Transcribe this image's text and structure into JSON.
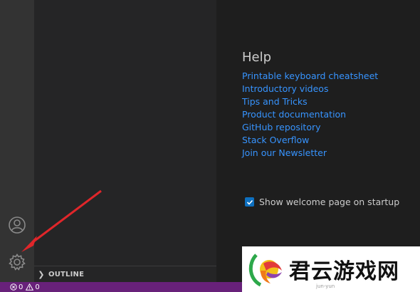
{
  "help": {
    "title": "Help",
    "links": [
      "Printable keyboard cheatsheet",
      "Introductory videos",
      "Tips and Tricks",
      "Product documentation",
      "GitHub repository",
      "Stack Overflow",
      "Join our Newsletter"
    ]
  },
  "startup": {
    "label": "Show welcome page on startup",
    "checked": true
  },
  "sidebar": {
    "outline_label": "OUTLINE"
  },
  "status": {
    "errors": "0",
    "warnings": "0"
  },
  "activity_bar": {
    "icons": [
      "account-icon",
      "manage-gear-icon"
    ]
  },
  "watermark": {
    "text": "君云游戏网",
    "domain": "jun-yun"
  },
  "colors": {
    "link": "#3794ff",
    "status_bar": "#68217a",
    "checkbox": "#0e70c0",
    "annotation_arrow": "#e0262a"
  }
}
